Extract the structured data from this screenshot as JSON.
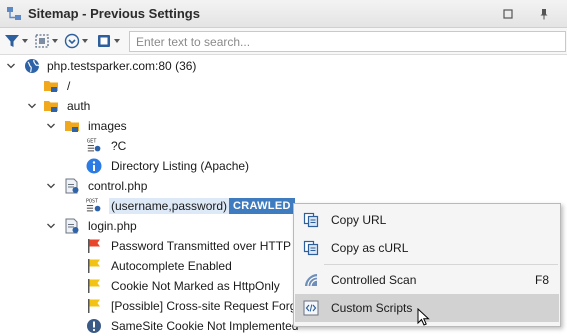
{
  "window": {
    "title": "Sitemap - Previous Settings"
  },
  "toolbar": {
    "search_placeholder": "Enter text to search..."
  },
  "tree": {
    "root": {
      "label": "php.testsparker.com:80 (36)"
    },
    "slash": {
      "label": "/"
    },
    "auth": {
      "label": "auth"
    },
    "images": {
      "label": "images"
    },
    "images_c": {
      "label": "?C",
      "method": "GET"
    },
    "dirlisting": {
      "label": "Directory Listing (Apache)"
    },
    "control": {
      "label": "control.php"
    },
    "control_post": {
      "label": "(username,password)",
      "method": "POST",
      "badge": "CRAWLED"
    },
    "login": {
      "label": "login.php"
    },
    "issues": [
      {
        "label": "Password Transmitted over HTTP",
        "severity_color": "#e8462b"
      },
      {
        "label": "Autocomplete Enabled",
        "severity_color": "#f2c313"
      },
      {
        "label": "Cookie Not Marked as HttpOnly",
        "severity_color": "#f2c313"
      },
      {
        "label": "[Possible] Cross-site Request Forge",
        "severity_color": "#f2c313"
      },
      {
        "label": "SameSite Cookie Not Implemented",
        "severity_color": "#3a5a86"
      }
    ]
  },
  "context_menu": {
    "items": [
      {
        "label": "Copy URL",
        "shortcut": ""
      },
      {
        "label": "Copy as cURL",
        "shortcut": ""
      },
      {
        "label": "Controlled Scan",
        "shortcut": "F8"
      },
      {
        "label": "Custom Scripts",
        "shortcut": ""
      }
    ]
  },
  "colors": {
    "accent": "#3f7cbf",
    "folder": "#f0a81e",
    "info": "#2c7be5",
    "menu_highlight": "#d2d2d2"
  }
}
